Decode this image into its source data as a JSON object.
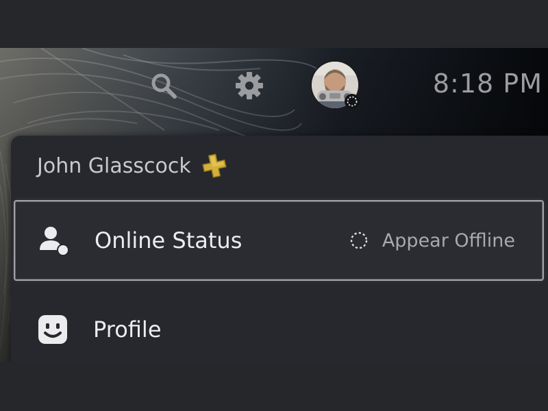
{
  "status_bar": {
    "time": "8:18 PM",
    "search_icon": "search-icon",
    "settings_icon": "gear-icon",
    "avatar_alt": "user-avatar"
  },
  "profile_menu": {
    "user_name": "John Glasscock",
    "membership_icon": "playstation-plus-icon",
    "membership_color": "#d4b13a",
    "items": [
      {
        "label": "Online Status",
        "icon": "person-status-icon",
        "value": "Appear Offline",
        "value_icon": "dashed-circle-offline-icon",
        "focused": true
      },
      {
        "label": "Profile",
        "icon": "smiley-face-icon",
        "focused": false
      }
    ]
  },
  "colors": {
    "panel": "#26282d",
    "focus_border": "#9fa1a7",
    "text_primary": "#ededef",
    "text_secondary": "#a9a9ae"
  }
}
